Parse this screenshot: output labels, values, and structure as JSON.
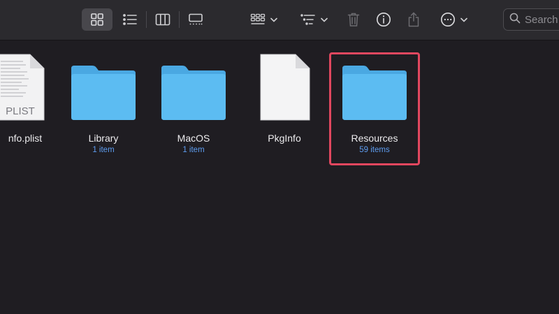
{
  "toolbar": {
    "buttons": [
      {
        "name": "icon-view",
        "icon": "grid-icon",
        "active": true
      },
      {
        "name": "list-view",
        "icon": "list-icon"
      },
      {
        "name": "column-view",
        "icon": "columns-icon"
      },
      {
        "name": "gallery-view",
        "icon": "gallery-icon"
      },
      {
        "name": "group-by",
        "icon": "group-grid-icon"
      },
      {
        "name": "sort-by",
        "icon": "sort-lines-icon"
      },
      {
        "name": "delete",
        "icon": "trash-icon"
      },
      {
        "name": "get-info",
        "icon": "info-icon"
      },
      {
        "name": "share",
        "icon": "share-icon"
      },
      {
        "name": "more-actions",
        "icon": "ellipsis-circle-icon"
      }
    ],
    "search": {
      "placeholder": "Search"
    }
  },
  "files": [
    {
      "name": "Info.plist",
      "visible_name": "nfo.plist",
      "type": "document",
      "badge": "PLIST",
      "meta": ""
    },
    {
      "name": "Library",
      "type": "folder",
      "meta": "1 item"
    },
    {
      "name": "MacOS",
      "type": "folder",
      "meta": "1 item"
    },
    {
      "name": "PkgInfo",
      "type": "document",
      "meta": ""
    },
    {
      "name": "Resources",
      "type": "folder",
      "meta": "59 items",
      "selected": true
    }
  ],
  "colors": {
    "background": "#1f1d22",
    "toolbar": "#2b2a2e",
    "folder": "#5ab8ee",
    "meta_text": "#5e9df0",
    "highlight": "#e1475f"
  }
}
